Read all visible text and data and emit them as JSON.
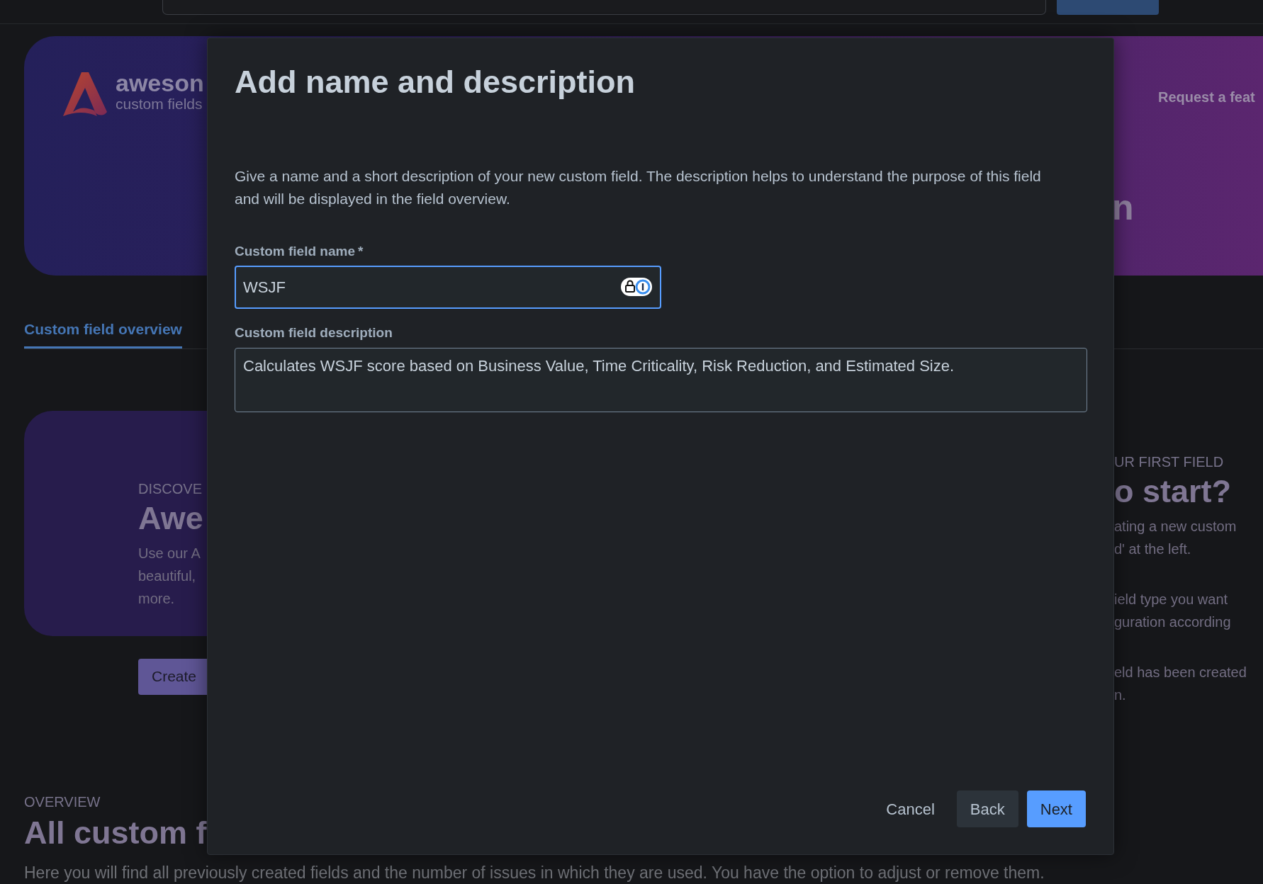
{
  "banner": {
    "logo_text": "aweson",
    "logo_subtitle": "custom fields",
    "link": "Request a feat",
    "heading_fragment": "n"
  },
  "tabs": [
    {
      "label": "Custom field overview",
      "selected": true
    }
  ],
  "discover_card": {
    "eyebrow": "DISCOVE",
    "heading": "Awe",
    "body": "Use our A\nbeautiful,\nmore.",
    "button": "Create"
  },
  "getting_started": {
    "eyebrow": "UR FIRST FIELD",
    "heading": "o start?",
    "paragraphs": [
      "ating a new custom\nd' at the left.",
      "ield type you want\nguration according",
      "eld has been created\nn."
    ]
  },
  "overview": {
    "eyebrow": "OVERVIEW",
    "heading": "All custom f",
    "description": "Here you will find all previously created fields and the number of issues in which they are used. You have the option to adjust or remove them."
  },
  "modal": {
    "title": "Add name and description",
    "description": "Give a name and a short description of your new custom field. The description helps to understand the purpose of this field and will be displayed in the field overview.",
    "fields": [
      {
        "kind": "input",
        "label": "Custom field name",
        "required_mark": "*",
        "value": "WSJF",
        "focused": true
      },
      {
        "kind": "textarea",
        "label": "Custom field description",
        "value": "Calculates WSJF score based on Business Value, Time Criticality, Risk Reduction, and Estimated Size.",
        "focused": false
      }
    ],
    "buttons": [
      {
        "label": "Cancel",
        "kind": "subtle"
      },
      {
        "label": "Back",
        "kind": "default"
      },
      {
        "label": "Next",
        "kind": "primary"
      }
    ]
  }
}
